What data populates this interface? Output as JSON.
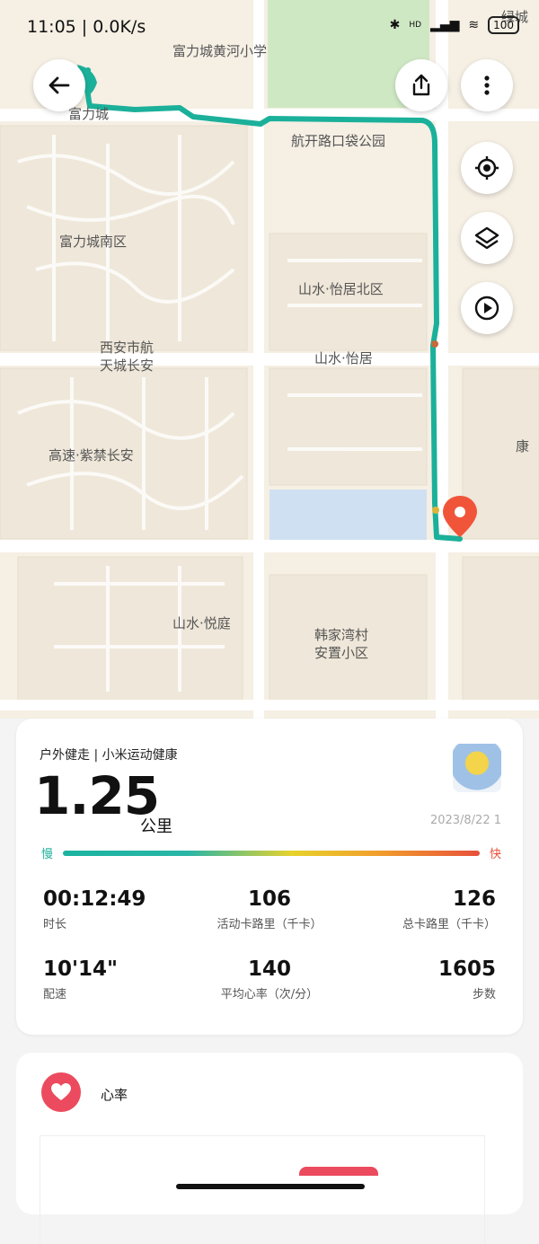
{
  "status_bar": {
    "time": "11:05",
    "speed": "0.0K/s",
    "network": "HD",
    "battery": "100"
  },
  "map": {
    "labels": [
      "绿城",
      "富力城黄河小学",
      "富力城",
      "航开路口袋公园",
      "富力城南区",
      "山水·怡居北区",
      "山水·怡居",
      "西安市航",
      "天城长安",
      "高速·紫禁长安",
      "康",
      "山水·悦庭",
      "韩家湾村",
      "安置小区"
    ],
    "route_color": "#1bb09a",
    "pin_color": "#f0553a",
    "icons": [
      "back-arrow-icon",
      "share-icon",
      "more-vertical-icon",
      "locate-icon",
      "layers-icon",
      "play-icon"
    ]
  },
  "summary": {
    "source": "户外健走 | 小米运动健康",
    "distance": "1.25",
    "unit": "公里",
    "date": "2023/8/22 1",
    "pace_slow": "慢",
    "pace_fast": "快",
    "stats": [
      {
        "value": "00:12:49",
        "label": "时长"
      },
      {
        "value": "106",
        "label": "活动卡路里（千卡）"
      },
      {
        "value": "126",
        "label": "总卡路里（千卡）"
      },
      {
        "value": "10'14\"",
        "label": "配速"
      },
      {
        "value": "140",
        "label": "平均心率（次/分）"
      },
      {
        "value": "1605",
        "label": "步数"
      }
    ]
  },
  "heart_rate": {
    "title": "心率",
    "accent": "#ec4a5e"
  }
}
